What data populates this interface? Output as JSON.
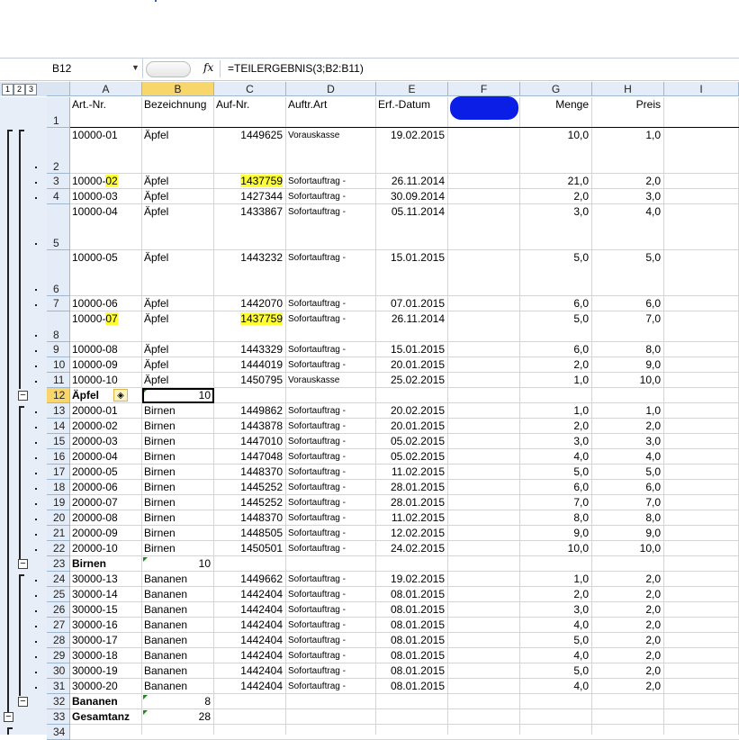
{
  "name_box": "B12",
  "formula_bar": {
    "fx": "fx",
    "formula": "=TEILERGEBNIS(3;B2:B11)"
  },
  "outline_levels": [
    "1",
    "2",
    "3"
  ],
  "columns": [
    "A",
    "B",
    "C",
    "D",
    "E",
    "F",
    "G",
    "H",
    "I"
  ],
  "header_row": {
    "a": "Art.-Nr.",
    "b": "Bezeichnung",
    "c": "Auf-Nr.",
    "d": "Auftr.Art",
    "e": "Erf.-Datum",
    "f": "",
    "g": "Menge",
    "h": "Preis"
  },
  "rows": [
    {
      "n": "2",
      "a": "10000-01",
      "b": "Äpfel",
      "c": "1449625",
      "d": "Vorauskasse",
      "e": "19.02.2015",
      "g": "10,0",
      "h": "1,0"
    },
    {
      "n": "3",
      "a": "10000-02",
      "b": "Äpfel",
      "c": "1437759",
      "d": "Sofortauftrag -",
      "e": "26.11.2014",
      "g": "21,0",
      "h": "2,0"
    },
    {
      "n": "4",
      "a": "10000-03",
      "b": "Äpfel",
      "c": "1427344",
      "d": "Sofortauftrag -",
      "e": "30.09.2014",
      "g": "2,0",
      "h": "3,0"
    },
    {
      "n": "5",
      "a": "10000-04",
      "b": "Äpfel",
      "c": "1433867",
      "d": "Sofortauftrag -",
      "e": "05.11.2014",
      "g": "3,0",
      "h": "4,0"
    },
    {
      "n": "6",
      "a": "10000-05",
      "b": "Äpfel",
      "c": "1443232",
      "d": "Sofortauftrag -",
      "e": "15.01.2015",
      "g": "5,0",
      "h": "5,0"
    },
    {
      "n": "7",
      "a": "10000-06",
      "b": "Äpfel",
      "c": "1442070",
      "d": "Sofortauftrag -",
      "e": "07.01.2015",
      "g": "6,0",
      "h": "6,0"
    },
    {
      "n": "8",
      "a": "10000-07",
      "b": "Äpfel",
      "c": "1437759",
      "d": "Sofortauftrag -",
      "e": "26.11.2014",
      "g": "5,0",
      "h": "7,0"
    },
    {
      "n": "9",
      "a": "10000-08",
      "b": "Äpfel",
      "c": "1443329",
      "d": "Sofortauftrag -",
      "e": "15.01.2015",
      "g": "6,0",
      "h": "8,0"
    },
    {
      "n": "10",
      "a": "10000-09",
      "b": "Äpfel",
      "c": "1444019",
      "d": "Sofortauftrag -",
      "e": "20.01.2015",
      "g": "2,0",
      "h": "9,0"
    },
    {
      "n": "11",
      "a": "10000-10",
      "b": "Äpfel",
      "c": "1450795",
      "d": "Vorauskasse",
      "e": "25.02.2015",
      "g": "1,0",
      "h": "10,0"
    },
    {
      "n": "12",
      "a": "Äpfel",
      "b": "10",
      "c": "",
      "d": "",
      "e": "",
      "g": "",
      "h": ""
    },
    {
      "n": "13",
      "a": "20000-01",
      "b": "Birnen",
      "c": "1449862",
      "d": "Sofortauftrag -",
      "e": "20.02.2015",
      "g": "1,0",
      "h": "1,0"
    },
    {
      "n": "14",
      "a": "20000-02",
      "b": "Birnen",
      "c": "1443878",
      "d": "Sofortauftrag -",
      "e": "20.01.2015",
      "g": "2,0",
      "h": "2,0"
    },
    {
      "n": "15",
      "a": "20000-03",
      "b": "Birnen",
      "c": "1447010",
      "d": "Sofortauftrag -",
      "e": "05.02.2015",
      "g": "3,0",
      "h": "3,0"
    },
    {
      "n": "16",
      "a": "20000-04",
      "b": "Birnen",
      "c": "1447048",
      "d": "Sofortauftrag -",
      "e": "05.02.2015",
      "g": "4,0",
      "h": "4,0"
    },
    {
      "n": "17",
      "a": "20000-05",
      "b": "Birnen",
      "c": "1448370",
      "d": "Sofortauftrag -",
      "e": "11.02.2015",
      "g": "5,0",
      "h": "5,0"
    },
    {
      "n": "18",
      "a": "20000-06",
      "b": "Birnen",
      "c": "1445252",
      "d": "Sofortauftrag -",
      "e": "28.01.2015",
      "g": "6,0",
      "h": "6,0"
    },
    {
      "n": "19",
      "a": "20000-07",
      "b": "Birnen",
      "c": "1445252",
      "d": "Sofortauftrag -",
      "e": "28.01.2015",
      "g": "7,0",
      "h": "7,0"
    },
    {
      "n": "20",
      "a": "20000-08",
      "b": "Birnen",
      "c": "1448370",
      "d": "Sofortauftrag -",
      "e": "11.02.2015",
      "g": "8,0",
      "h": "8,0"
    },
    {
      "n": "21",
      "a": "20000-09",
      "b": "Birnen",
      "c": "1448505",
      "d": "Sofortauftrag -",
      "e": "12.02.2015",
      "g": "9,0",
      "h": "9,0"
    },
    {
      "n": "22",
      "a": "20000-10",
      "b": "Birnen",
      "c": "1450501",
      "d": "Sofortauftrag -",
      "e": "24.02.2015",
      "g": "10,0",
      "h": "10,0"
    },
    {
      "n": "23",
      "a": "Birnen",
      "b": "10",
      "c": "",
      "d": "",
      "e": "",
      "g": "",
      "h": ""
    },
    {
      "n": "24",
      "a": "30000-13",
      "b": "Bananen",
      "c": "1449662",
      "d": "Sofortauftrag -",
      "e": "19.02.2015",
      "g": "1,0",
      "h": "2,0"
    },
    {
      "n": "25",
      "a": "30000-14",
      "b": "Bananen",
      "c": "1442404",
      "d": "Sofortauftrag -",
      "e": "08.01.2015",
      "g": "2,0",
      "h": "2,0"
    },
    {
      "n": "26",
      "a": "30000-15",
      "b": "Bananen",
      "c": "1442404",
      "d": "Sofortauftrag -",
      "e": "08.01.2015",
      "g": "3,0",
      "h": "2,0"
    },
    {
      "n": "27",
      "a": "30000-16",
      "b": "Bananen",
      "c": "1442404",
      "d": "Sofortauftrag -",
      "e": "08.01.2015",
      "g": "4,0",
      "h": "2,0"
    },
    {
      "n": "28",
      "a": "30000-17",
      "b": "Bananen",
      "c": "1442404",
      "d": "Sofortauftrag -",
      "e": "08.01.2015",
      "g": "5,0",
      "h": "2,0"
    },
    {
      "n": "29",
      "a": "30000-18",
      "b": "Bananen",
      "c": "1442404",
      "d": "Sofortauftrag -",
      "e": "08.01.2015",
      "g": "4,0",
      "h": "2,0"
    },
    {
      "n": "30",
      "a": "30000-19",
      "b": "Bananen",
      "c": "1442404",
      "d": "Sofortauftrag -",
      "e": "08.01.2015",
      "g": "5,0",
      "h": "2,0"
    },
    {
      "n": "31",
      "a": "30000-20",
      "b": "Bananen",
      "c": "1442404",
      "d": "Sofortauftrag -",
      "e": "08.01.2015",
      "g": "4,0",
      "h": "2,0"
    },
    {
      "n": "32",
      "a": "Bananen",
      "b": "8",
      "c": "",
      "d": "",
      "e": "",
      "g": "",
      "h": ""
    },
    {
      "n": "33",
      "a": "Gesamtanz",
      "b": "28",
      "c": "",
      "d": "",
      "e": "",
      "g": "",
      "h": ""
    },
    {
      "n": "34",
      "a": "",
      "b": "",
      "c": "",
      "d": "",
      "e": "",
      "g": "",
      "h": ""
    }
  ],
  "colors": {
    "header_fill": "#e4ecf7",
    "selected_header": "#f8d66c",
    "highlight": "#ffff35",
    "redaction": "#0a1ee6",
    "grid": "#d4d4d4"
  }
}
